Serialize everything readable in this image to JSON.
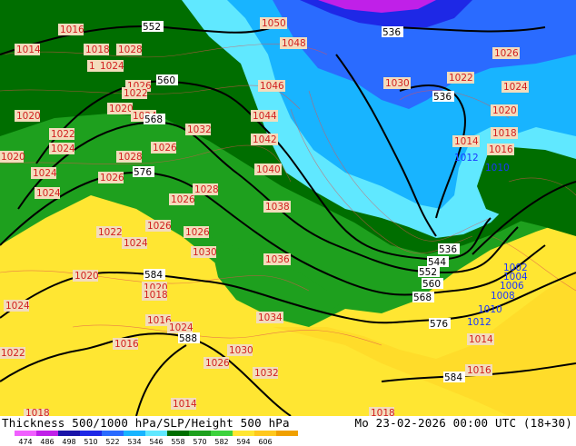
{
  "title": "Thickness 500/1000 hPa/SLP/Height 500 hPa",
  "valid_time": "Mo 23-02-2026 00:00 UTC (18+30)",
  "colorbar": {
    "labels": [
      "474",
      "486",
      "498",
      "510",
      "522",
      "534",
      "546",
      "558",
      "570",
      "582",
      "594",
      "606"
    ],
    "colors": [
      "#f060ff",
      "#c020e8",
      "#1a14a8",
      "#1e28e6",
      "#2a6bff",
      "#18b4ff",
      "#60e8ff",
      "#006e00",
      "#1ea01e",
      "#3cd23c",
      "#ffe632",
      "#ffc81e",
      "#f0a000"
    ]
  },
  "pressure_labels": [
    "1016",
    "1014",
    "1018",
    "1028",
    "1010",
    "1024",
    "1026",
    "1020",
    "1022",
    "1032",
    "1044",
    "1042",
    "1040",
    "1038",
    "1036",
    "1034",
    "1030",
    "1050",
    "1048",
    "1046",
    "1012",
    "1008",
    "1006",
    "1004",
    "1002"
  ],
  "height_labels": [
    "552",
    "560",
    "568",
    "576",
    "584",
    "588",
    "536",
    "544",
    "1044",
    "1016"
  ],
  "colors": {
    "pressure_red": "#d22020",
    "pressure_blue": "#1a37ff",
    "label_bg": "#f3dcbc"
  }
}
